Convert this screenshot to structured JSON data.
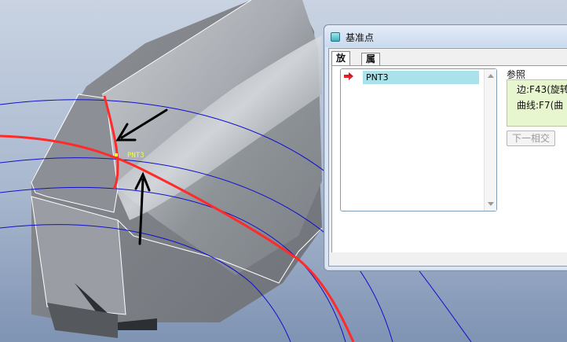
{
  "viewport": {
    "point_tag": "PNT3",
    "colors": {
      "background": "#9fb0c9",
      "model_face": "#8a8e94",
      "datum_curve": "#ff2a2a",
      "datum_arcs": "#0000cc",
      "annotation_arrow": "#000000",
      "point_tag": "#e8ff3a"
    }
  },
  "dialog": {
    "title": "基准点",
    "icon": "datum-point-icon",
    "tabs": [
      {
        "label": "放置",
        "active": true
      },
      {
        "label": "属性",
        "active": false
      }
    ],
    "points": [
      {
        "label": "PNT3",
        "selected": true,
        "icon": "red-arrow-icon"
      }
    ],
    "references": {
      "label": "参照",
      "items": [
        "边:F43(旋转",
        "曲线:F7(曲"
      ]
    },
    "next_button": "下一相交"
  }
}
